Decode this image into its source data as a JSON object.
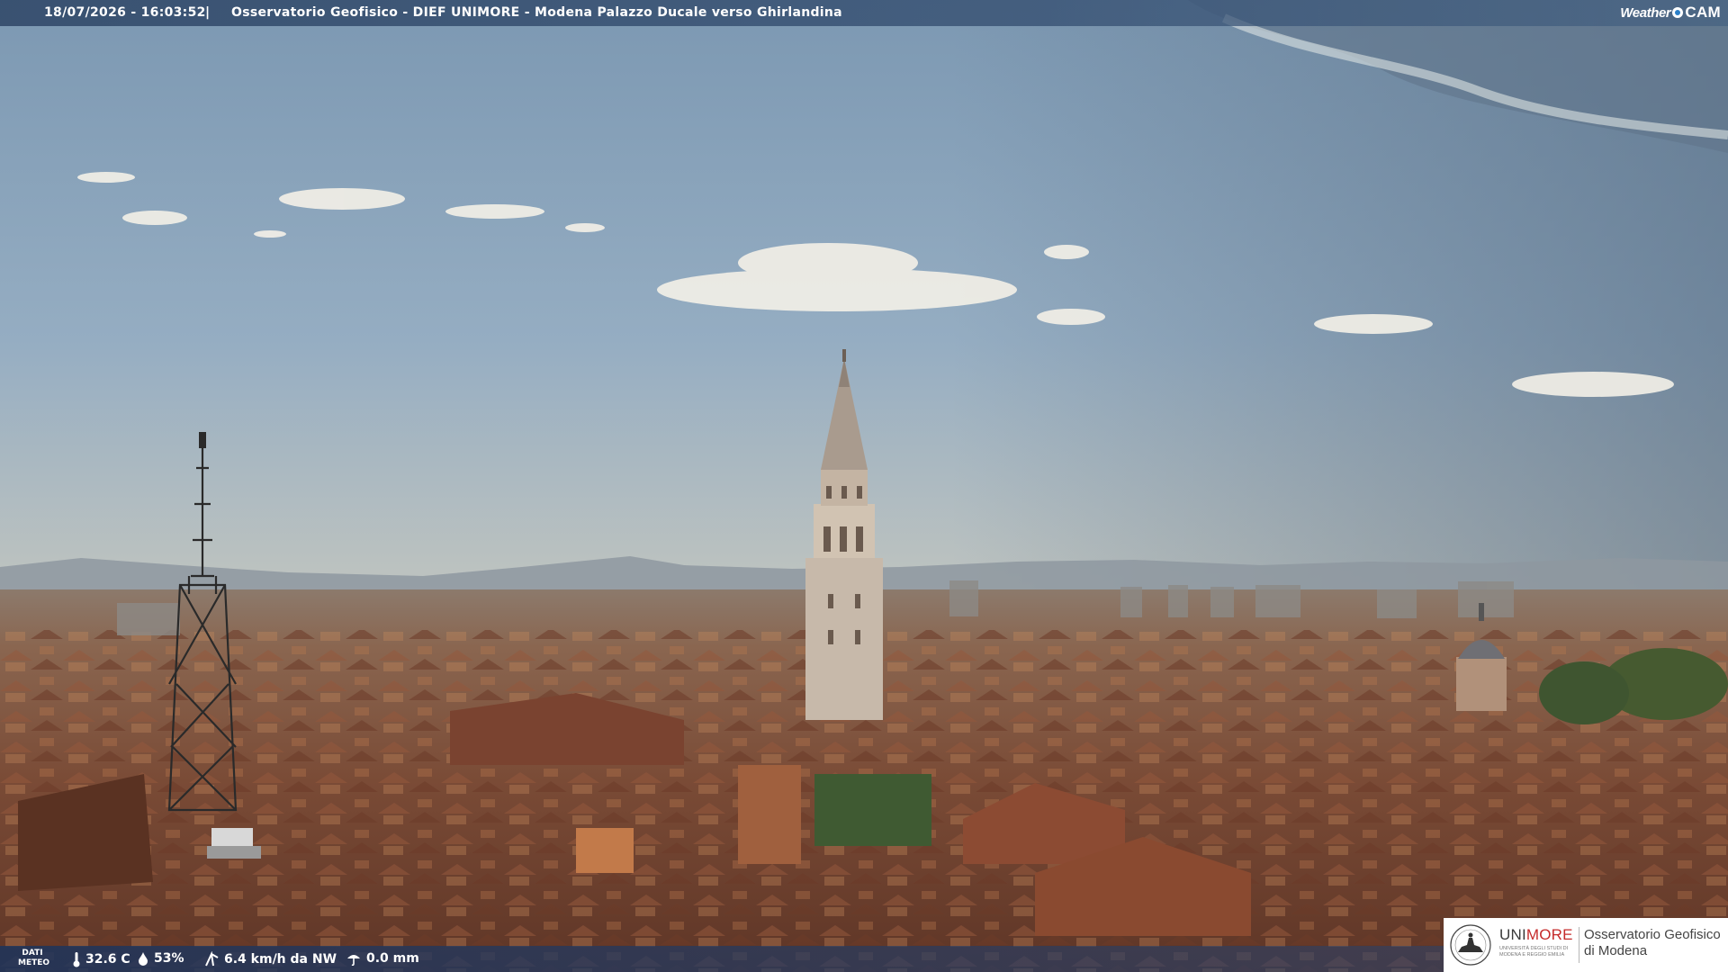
{
  "header": {
    "timestamp": "18/07/2026 - 16:03:52",
    "separator": "|",
    "title": "Osservatorio Geofisico - DIEF UNIMORE - Modena Palazzo Ducale verso Ghirlandina",
    "brand_left": "Weather",
    "brand_right": "CAM"
  },
  "weather": {
    "label_line1": "DATI",
    "label_line2": "METEO",
    "temperature": "32.6 C",
    "humidity": "53%",
    "wind": "6.4 km/h da NW",
    "rain": "0.0 mm",
    "icons": [
      "thermometer-icon",
      "humidity-drop-icon",
      "wind-icon",
      "rain-icon"
    ]
  },
  "logo": {
    "uni": "UNI",
    "more": "MORE",
    "university_line1": "UNIVERSITÀ DEGLI STUDI DI",
    "university_line2": "MODENA E REGGIO EMILIA",
    "observatory_line1": "Osservatorio Geofisico",
    "observatory_line2": "di Modena"
  },
  "colors": {
    "sky_top": "#7f9cb6",
    "sky_horizon": "#c9c4b6",
    "roofs": "#7a4a34",
    "unimore_red": "#c52a2a",
    "bar_blue": "#304868"
  }
}
